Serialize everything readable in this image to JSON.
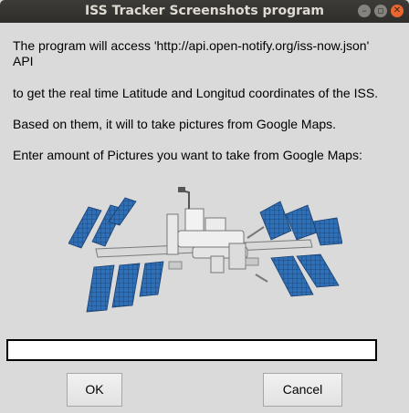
{
  "window": {
    "title": "ISS Tracker Screenshots program",
    "minimize_glyph": "–",
    "maximize_glyph": "▫",
    "close_glyph": "✕"
  },
  "message": {
    "line1": "The program will access 'http://api.open-notify.org/iss-now.json'",
    "line1b": "API",
    "line2": "to get the real time Latitude and Longitud coordinates of the ISS.",
    "line3": "Based on them, it will to take pictures from Google Maps.",
    "line4": "Enter amount of Pictures you want to take from Google Maps:"
  },
  "illustration": {
    "subject": "international-space-station"
  },
  "entry": {
    "value": ""
  },
  "buttons": {
    "ok_label": "OK",
    "cancel_label": "Cancel"
  },
  "colors": {
    "panel": "#2b6cb0",
    "titlebar": "#3c3b37",
    "close": "#e9662f"
  }
}
